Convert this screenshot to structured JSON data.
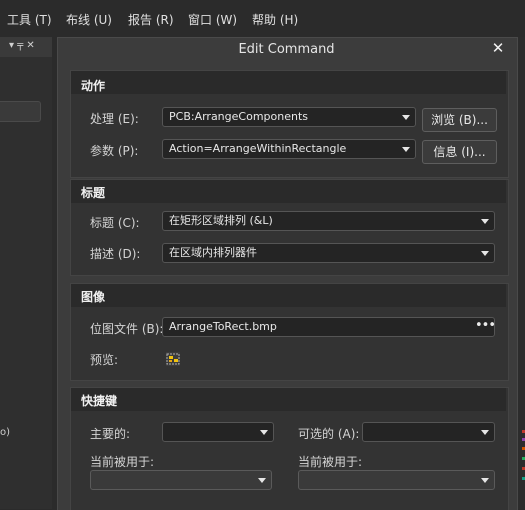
{
  "menu": [
    {
      "label": "工具 (T)"
    },
    {
      "label": "布线 (U)"
    },
    {
      "label": "报告 (R)"
    },
    {
      "label": "窗口 (W)"
    },
    {
      "label": "帮助 (H)"
    }
  ],
  "dialog": {
    "title": "Edit Command",
    "action": {
      "header": "动作",
      "process_label": "处理 (E):",
      "process_value": "PCB:ArrangeComponents",
      "browse_button": "浏览 (B)...",
      "param_label": "参数 (P):",
      "param_value": "Action=ArrangeWithinRectangle",
      "info_button": "信息 (I)..."
    },
    "title_group": {
      "header": "标题",
      "caption_label": "标题 (C):",
      "caption_value": "在矩形区域排列 (&L)",
      "desc_label": "描述 (D):",
      "desc_value": "在区域内排列器件"
    },
    "image": {
      "header": "图像",
      "bitmap_label": "位图文件 (B):",
      "bitmap_value": "ArrangeToRect.bmp",
      "more": "•••",
      "preview_label": "预览:"
    },
    "shortcut": {
      "header": "快捷键",
      "primary_label": "主要的:",
      "primary_value": "",
      "secondary_label": "可选的 (A):",
      "secondary_value": "",
      "used_by_left": "当前被用于:",
      "used_by_right": "当前被用于:"
    }
  },
  "left_panel": {
    "pin": "▾ ╤ ✕",
    "fragment": "o)"
  }
}
